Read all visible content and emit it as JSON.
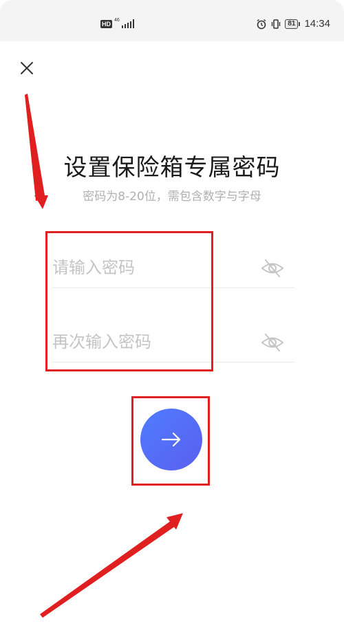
{
  "status_bar": {
    "hd": "HD",
    "network": "46",
    "battery": "81",
    "time": "14:34"
  },
  "icons": {
    "close": "close-icon",
    "eye": "eye-off-icon",
    "arrow": "arrow-right-icon",
    "alarm": "alarm-icon",
    "vibrate": "vibrate-icon"
  },
  "page": {
    "title": "设置保险箱专属密码",
    "subtitle": "密码为8-20位，需包含数字与字母"
  },
  "form": {
    "password_placeholder": "请输入密码",
    "confirm_placeholder": "再次输入密码"
  },
  "colors": {
    "annotation": "#e02020",
    "accent": "#4f7cff"
  }
}
